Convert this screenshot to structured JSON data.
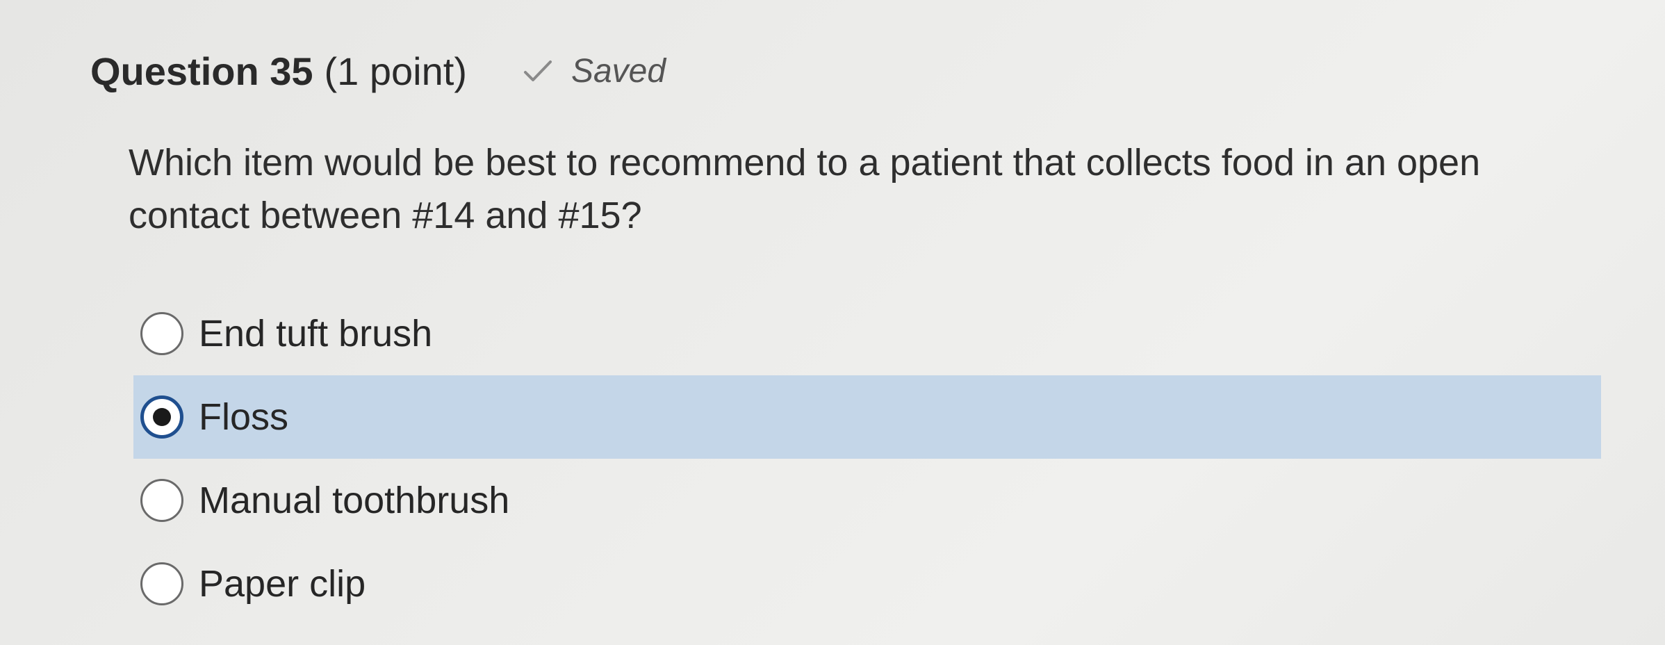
{
  "question": {
    "title": "Question 35",
    "points": "(1 point)",
    "status_icon": "check-icon",
    "status_text": "Saved",
    "text": "Which item would be best to recommend to a patient that collects food in an open contact between #14 and #15?"
  },
  "options": [
    {
      "label": "End tuft brush",
      "selected": false
    },
    {
      "label": "Floss",
      "selected": true
    },
    {
      "label": "Manual toothbrush",
      "selected": false
    },
    {
      "label": "Paper clip",
      "selected": false
    }
  ],
  "colors": {
    "selected_row": "#c4d6e8",
    "radio_checked_border": "#1f4f8f"
  }
}
